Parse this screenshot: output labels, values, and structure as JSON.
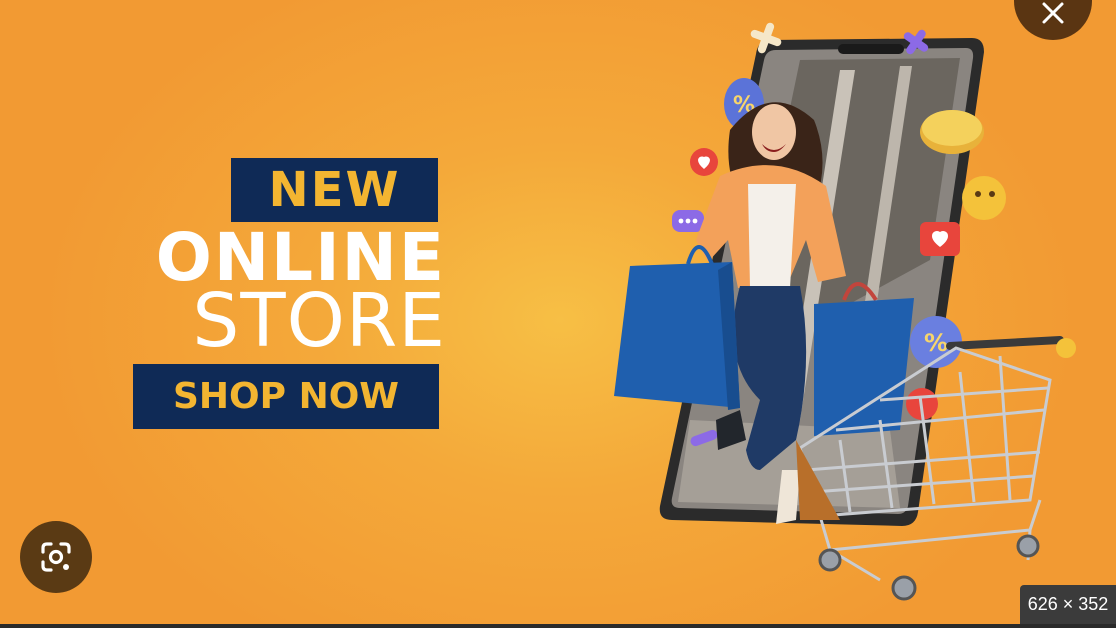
{
  "banner": {
    "new_label": "NEW",
    "online_label": "ONLINE",
    "store_label": "STORE",
    "shop_now_label": "SHOP NOW"
  },
  "overlay": {
    "close_icon": "close-icon",
    "lens_icon": "google-lens-icon",
    "dimensions": "626 × 352"
  },
  "colors": {
    "background": "#f4a93a",
    "navy": "#0f2a56",
    "gold_text": "#f3b531",
    "bag_blue": "#1f5fae",
    "jacket_orange": "#f3a15a"
  }
}
